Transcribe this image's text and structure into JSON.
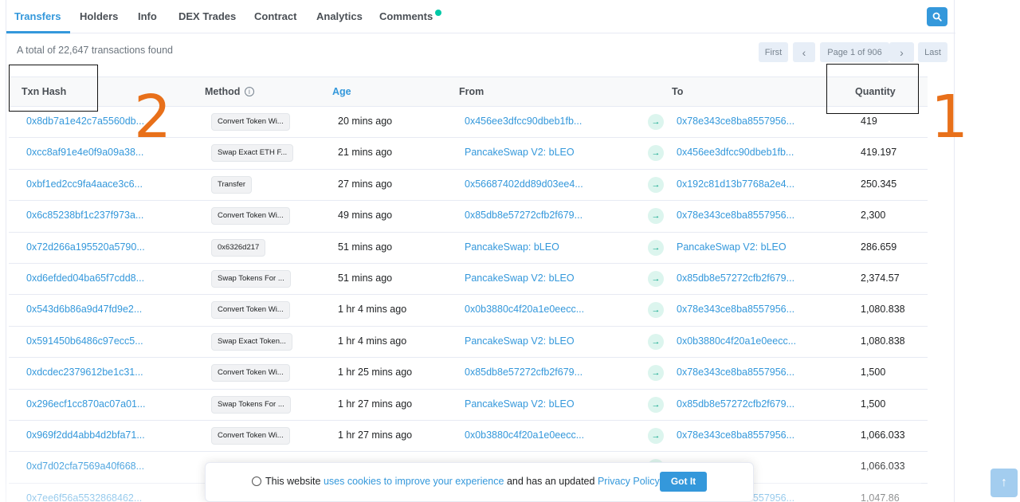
{
  "tabs": [
    {
      "label": "Transfers",
      "active": true
    },
    {
      "label": "Holders"
    },
    {
      "label": "Info"
    },
    {
      "label": "DEX Trades"
    },
    {
      "label": "Contract"
    },
    {
      "label": "Analytics"
    },
    {
      "label": "Comments"
    }
  ],
  "summary": "A total of 22,647 transactions found",
  "pager": {
    "first": "First",
    "prev": "‹",
    "page": "Page 1 of 906",
    "next": "›",
    "last": "Last"
  },
  "columns": {
    "hash": "Txn Hash",
    "method": "Method",
    "age": "Age",
    "from": "From",
    "to": "To",
    "quantity": "Quantity"
  },
  "rows": [
    {
      "hash": "0x8db7a1e42c7a5560db...",
      "method": "Convert Token Wi...",
      "age": "20 mins ago",
      "from": "0x456ee3dfcc90dbeb1fb...",
      "to": "0x78e343ce8ba8557956...",
      "qty": "419"
    },
    {
      "hash": "0xcc8af91e4e0f9a09a38...",
      "method": "Swap Exact ETH F...",
      "age": "21 mins ago",
      "from": "PancakeSwap V2: bLEO",
      "to": "0x456ee3dfcc90dbeb1fb...",
      "qty": "419.197"
    },
    {
      "hash": "0xbf1ed2cc9fa4aace3c6...",
      "method": "Transfer",
      "age": "27 mins ago",
      "from": "0x56687402dd89d03ee4...",
      "to": "0x192c81d13b7768a2e4...",
      "qty": "250.345"
    },
    {
      "hash": "0x6c85238bf1c237f973a...",
      "method": "Convert Token Wi...",
      "age": "49 mins ago",
      "from": "0x85db8e57272cfb2f679...",
      "to": "0x78e343ce8ba8557956...",
      "qty": "2,300"
    },
    {
      "hash": "0x72d266a195520a5790...",
      "method": "0x6326d217",
      "age": "51 mins ago",
      "from": "PancakeSwap: bLEO",
      "to": "PancakeSwap V2: bLEO",
      "qty": "286.659"
    },
    {
      "hash": "0xd6efded04ba65f7cdd8...",
      "method": "Swap Tokens For ...",
      "age": "51 mins ago",
      "from": "PancakeSwap V2: bLEO",
      "to": "0x85db8e57272cfb2f679...",
      "qty": "2,374.57"
    },
    {
      "hash": "0x543d6b86a9d47fd9e2...",
      "method": "Convert Token Wi...",
      "age": "1 hr 4 mins ago",
      "from": "0x0b3880c4f20a1e0eecc...",
      "to": "0x78e343ce8ba8557956...",
      "qty": "1,080.838"
    },
    {
      "hash": "0x591450b6486c97ecc5...",
      "method": "Swap Exact Token...",
      "age": "1 hr 4 mins ago",
      "from": "PancakeSwap V2: bLEO",
      "to": "0x0b3880c4f20a1e0eecc...",
      "qty": "1,080.838"
    },
    {
      "hash": "0xdcdec2379612be1c31...",
      "method": "Convert Token Wi...",
      "age": "1 hr 25 mins ago",
      "from": "0x85db8e57272cfb2f679...",
      "to": "0x78e343ce8ba8557956...",
      "qty": "1,500"
    },
    {
      "hash": "0x296ecf1cc870ac07a01...",
      "method": "Swap Tokens For ...",
      "age": "1 hr 27 mins ago",
      "from": "PancakeSwap V2: bLEO",
      "to": "0x85db8e57272cfb2f679...",
      "qty": "1,500"
    },
    {
      "hash": "0x969f2dd4abb4d2bfa71...",
      "method": "Convert Token Wi...",
      "age": "1 hr 27 mins ago",
      "from": "0x0b3880c4f20a1e0eecc...",
      "to": "0x78e343ce8ba8557956...",
      "qty": "1,066.033"
    },
    {
      "hash": "0xd7d02cfa7569a40f668...",
      "method": "",
      "age": "",
      "from": "",
      "to": "0eecc...",
      "qty": "1,066.033"
    },
    {
      "hash": "0x7ee6f56a5532868462...",
      "method": "Convert Token Wi...",
      "age": "",
      "from": "",
      "to": "0x78e343ce8ba8557956...",
      "qty": "1,047.86"
    }
  ],
  "annotations": {
    "label_1": "1",
    "label_2": "2"
  },
  "cookie": {
    "text_before": "This website ",
    "link1": "uses cookies to improve your experience",
    "text_mid": " and has an updated ",
    "link2": "Privacy Policy.",
    "button": "Got It"
  },
  "colors": {
    "accent": "#3498db",
    "annotation": "#e8701a",
    "arrow": "#00a186"
  }
}
